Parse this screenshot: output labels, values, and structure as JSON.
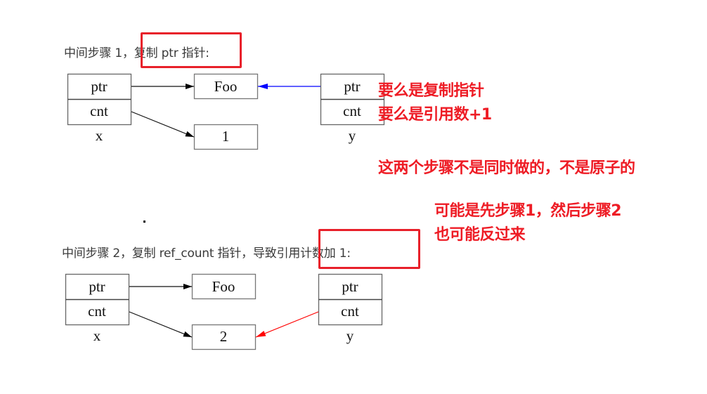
{
  "step1": {
    "caption_prefix": "中间步骤 1，",
    "caption_highlight": "复制 ptr 指针:",
    "diagram": {
      "x": {
        "fields": [
          "ptr",
          "cnt"
        ],
        "label": "x"
      },
      "y": {
        "fields": [
          "ptr",
          "cnt"
        ],
        "label": "y"
      },
      "target": "Foo",
      "count": "1",
      "new_edge": {
        "from": "y.ptr",
        "to": "Foo",
        "color": "#0000ff"
      }
    }
  },
  "step2": {
    "caption_prefix": "中间步骤 2，复制 ref_count 指针，导致",
    "caption_highlight": "引用计数加 1:",
    "diagram": {
      "x": {
        "fields": [
          "ptr",
          "cnt"
        ],
        "label": "x"
      },
      "y": {
        "fields": [
          "ptr",
          "cnt"
        ],
        "label": "y"
      },
      "target": "Foo",
      "count": "2",
      "new_edge": {
        "from": "y.cnt",
        "to": "count",
        "color": "#ff0000"
      }
    }
  },
  "annotations": {
    "line1": "要么是复制指针",
    "line2": "要么是引用数+1",
    "line3": "这两个步骤不是同时做的，不是原子的",
    "line4": "可能是先步骤1，然后步骤2",
    "line5": "也可能反过来",
    "color": "#ee1c25"
  }
}
